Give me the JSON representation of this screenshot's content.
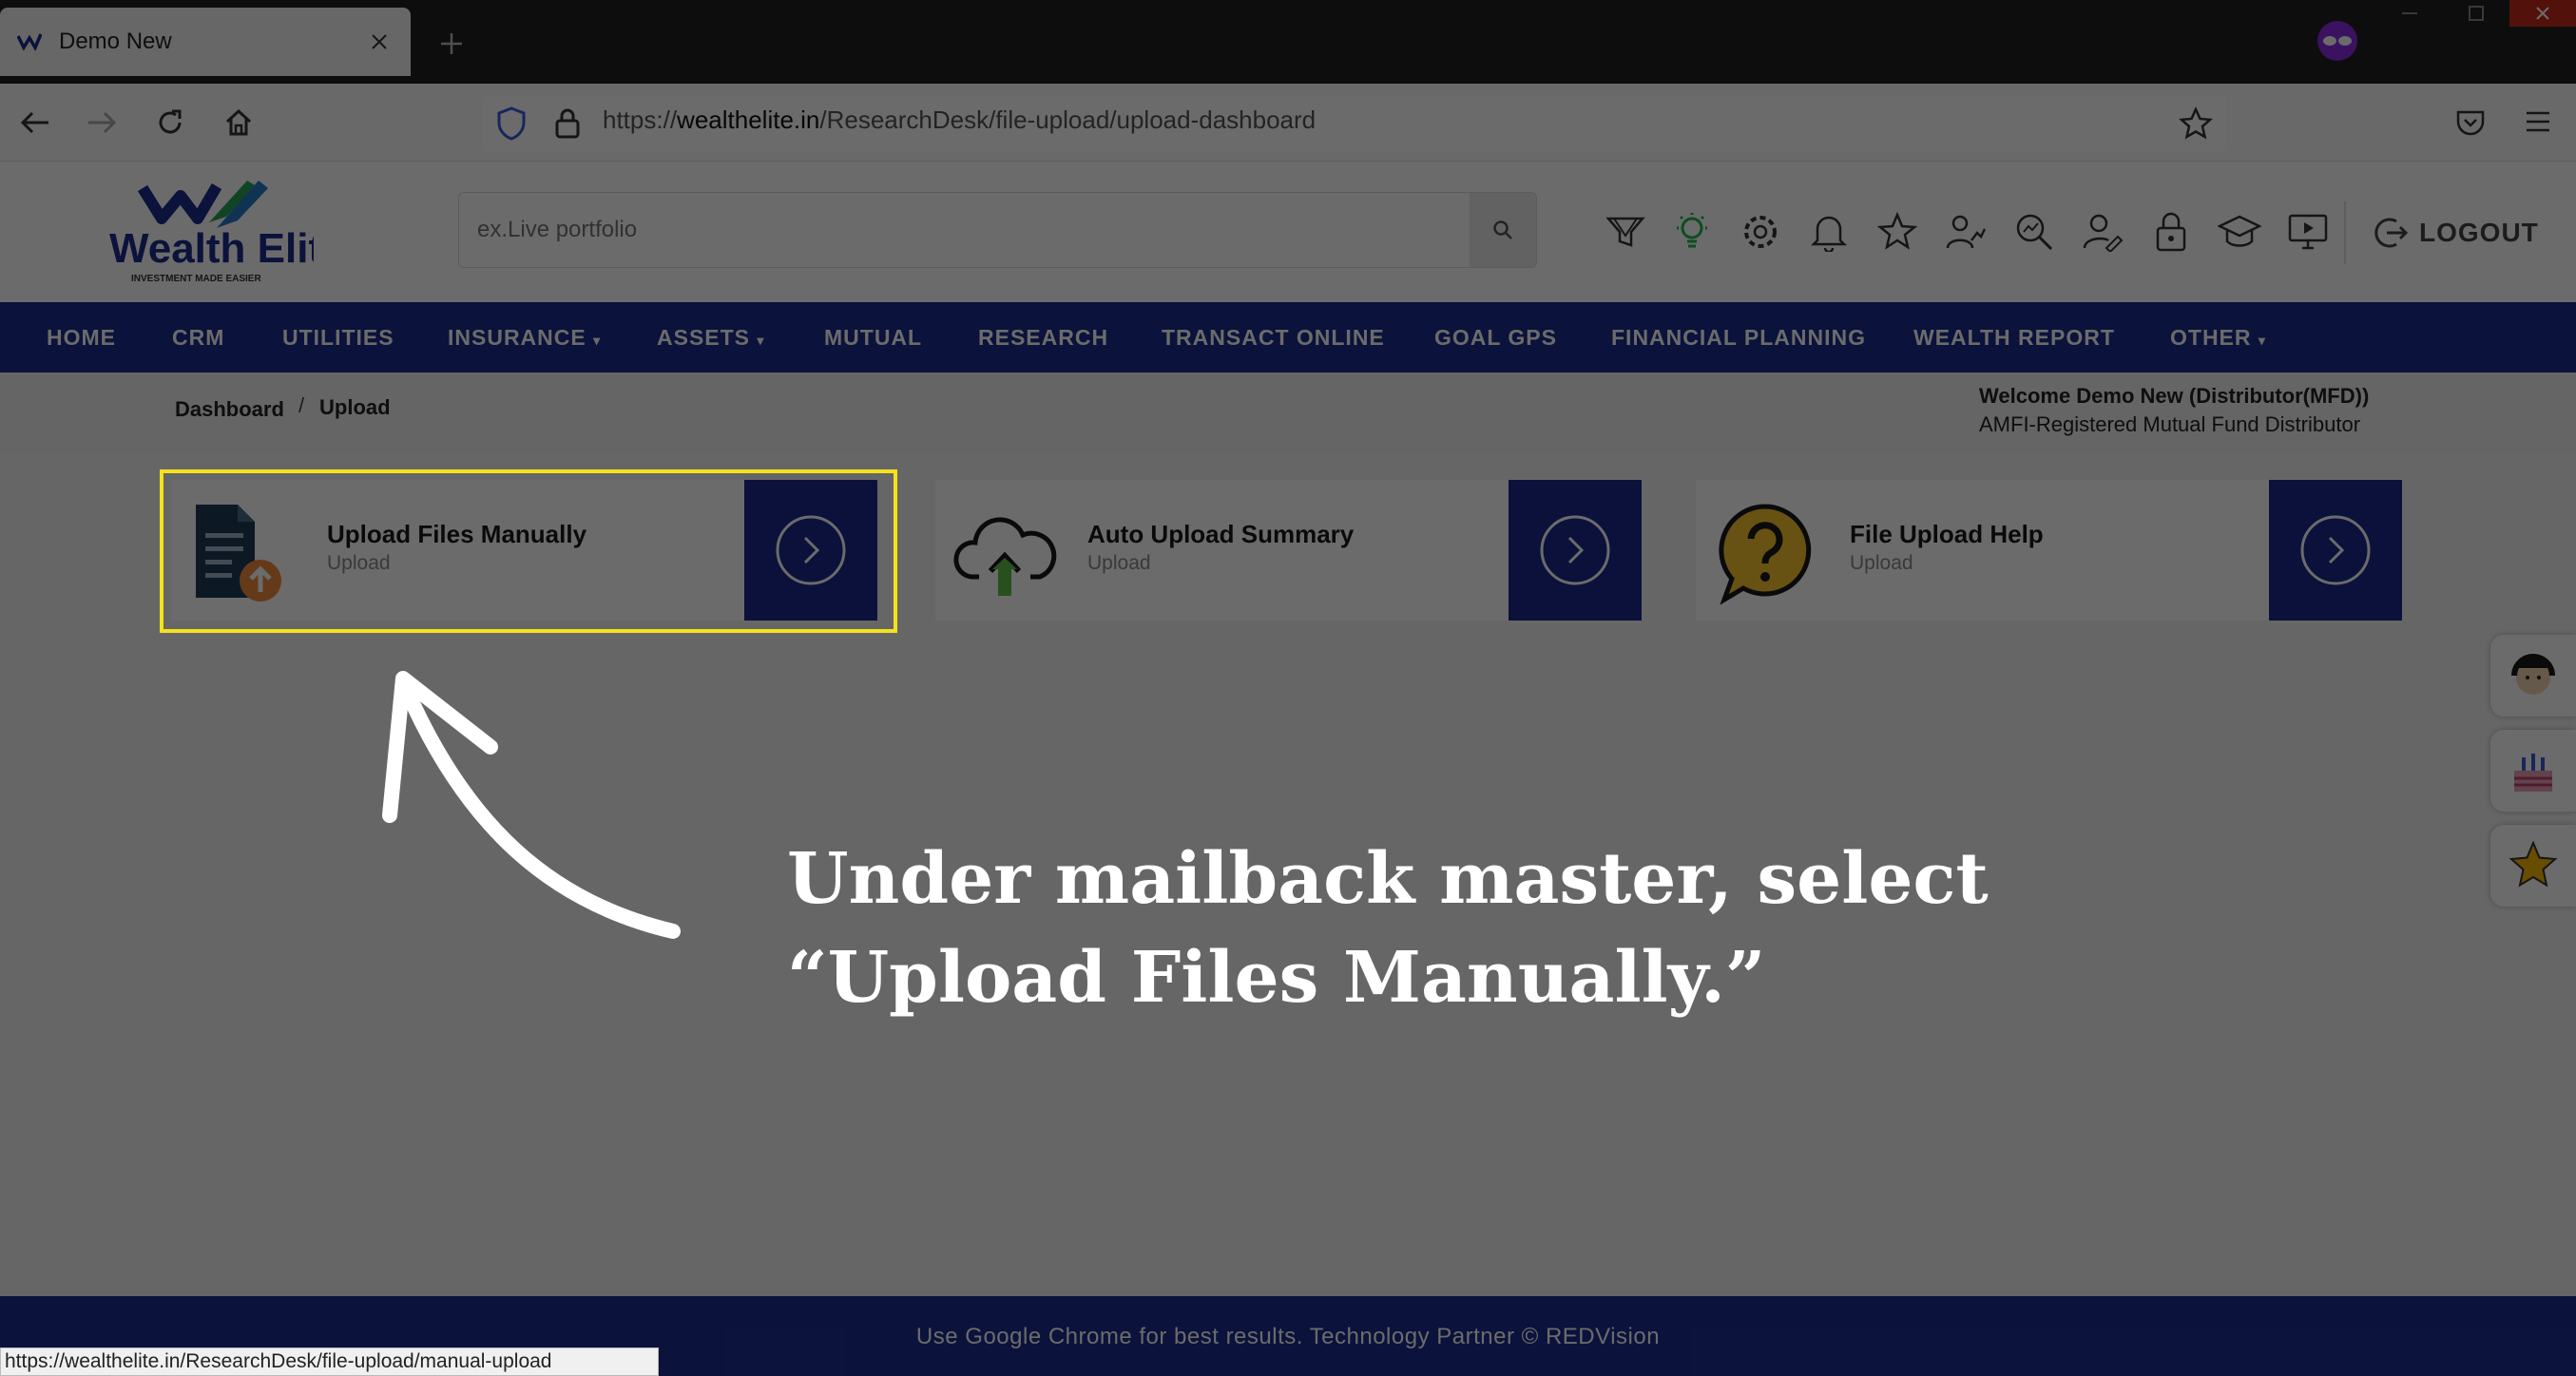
{
  "browser": {
    "tab_title": "Demo New",
    "url_scheme": "https://",
    "url_host": "wealthelite.in",
    "url_path": "/ResearchDesk/file-upload/upload-dashboard",
    "status_url": "https://wealthelite.in/ResearchDesk/file-upload/manual-upload"
  },
  "header": {
    "logo_text": "Wealth Elite",
    "logo_tagline": "INVESTMENT MADE EASIER",
    "search_placeholder": "ex.Live portfolio",
    "logout_label": "LOGOUT",
    "icons": [
      "filter-icon",
      "bulb-icon",
      "settings-icon",
      "bell-icon",
      "star-icon",
      "user-analytics-icon",
      "search-analytics-icon",
      "user-edit-icon",
      "lock-icon",
      "graduation-cap-icon",
      "presentation-icon"
    ]
  },
  "menu": [
    {
      "label": "HOME"
    },
    {
      "label": "CRM"
    },
    {
      "label": "UTILITIES"
    },
    {
      "label": "INSURANCE",
      "dropdown": true
    },
    {
      "label": "ASSETS",
      "dropdown": true
    },
    {
      "label": "MUTUAL"
    },
    {
      "label": "RESEARCH"
    },
    {
      "label": "TRANSACT ONLINE"
    },
    {
      "label": "GOAL GPS"
    },
    {
      "label": "FINANCIAL PLANNING"
    },
    {
      "label": "WEALTH REPORT"
    },
    {
      "label": "OTHER",
      "dropdown": true
    }
  ],
  "breadcrumb": {
    "root": "Dashboard",
    "sep": "/",
    "current": "Upload"
  },
  "welcome": {
    "line1": "Welcome Demo New (Distributor(MFD))",
    "line2": "AMFI-Registered Mutual Fund Distributor"
  },
  "cards": [
    {
      "title": "Upload Files Manually",
      "subtitle": "Upload"
    },
    {
      "title": "Auto Upload Summary",
      "subtitle": "Upload"
    },
    {
      "title": "File Upload Help",
      "subtitle": "Upload"
    }
  ],
  "footer": {
    "text": "Use Google Chrome for best results. Technology Partner © REDVision"
  },
  "annotation": {
    "line1": "Under mailback master, select",
    "line2": "“Upload Files Manually.”"
  },
  "colors": {
    "nav_blue": "#1c2d8e",
    "highlight": "#f5e21b"
  }
}
